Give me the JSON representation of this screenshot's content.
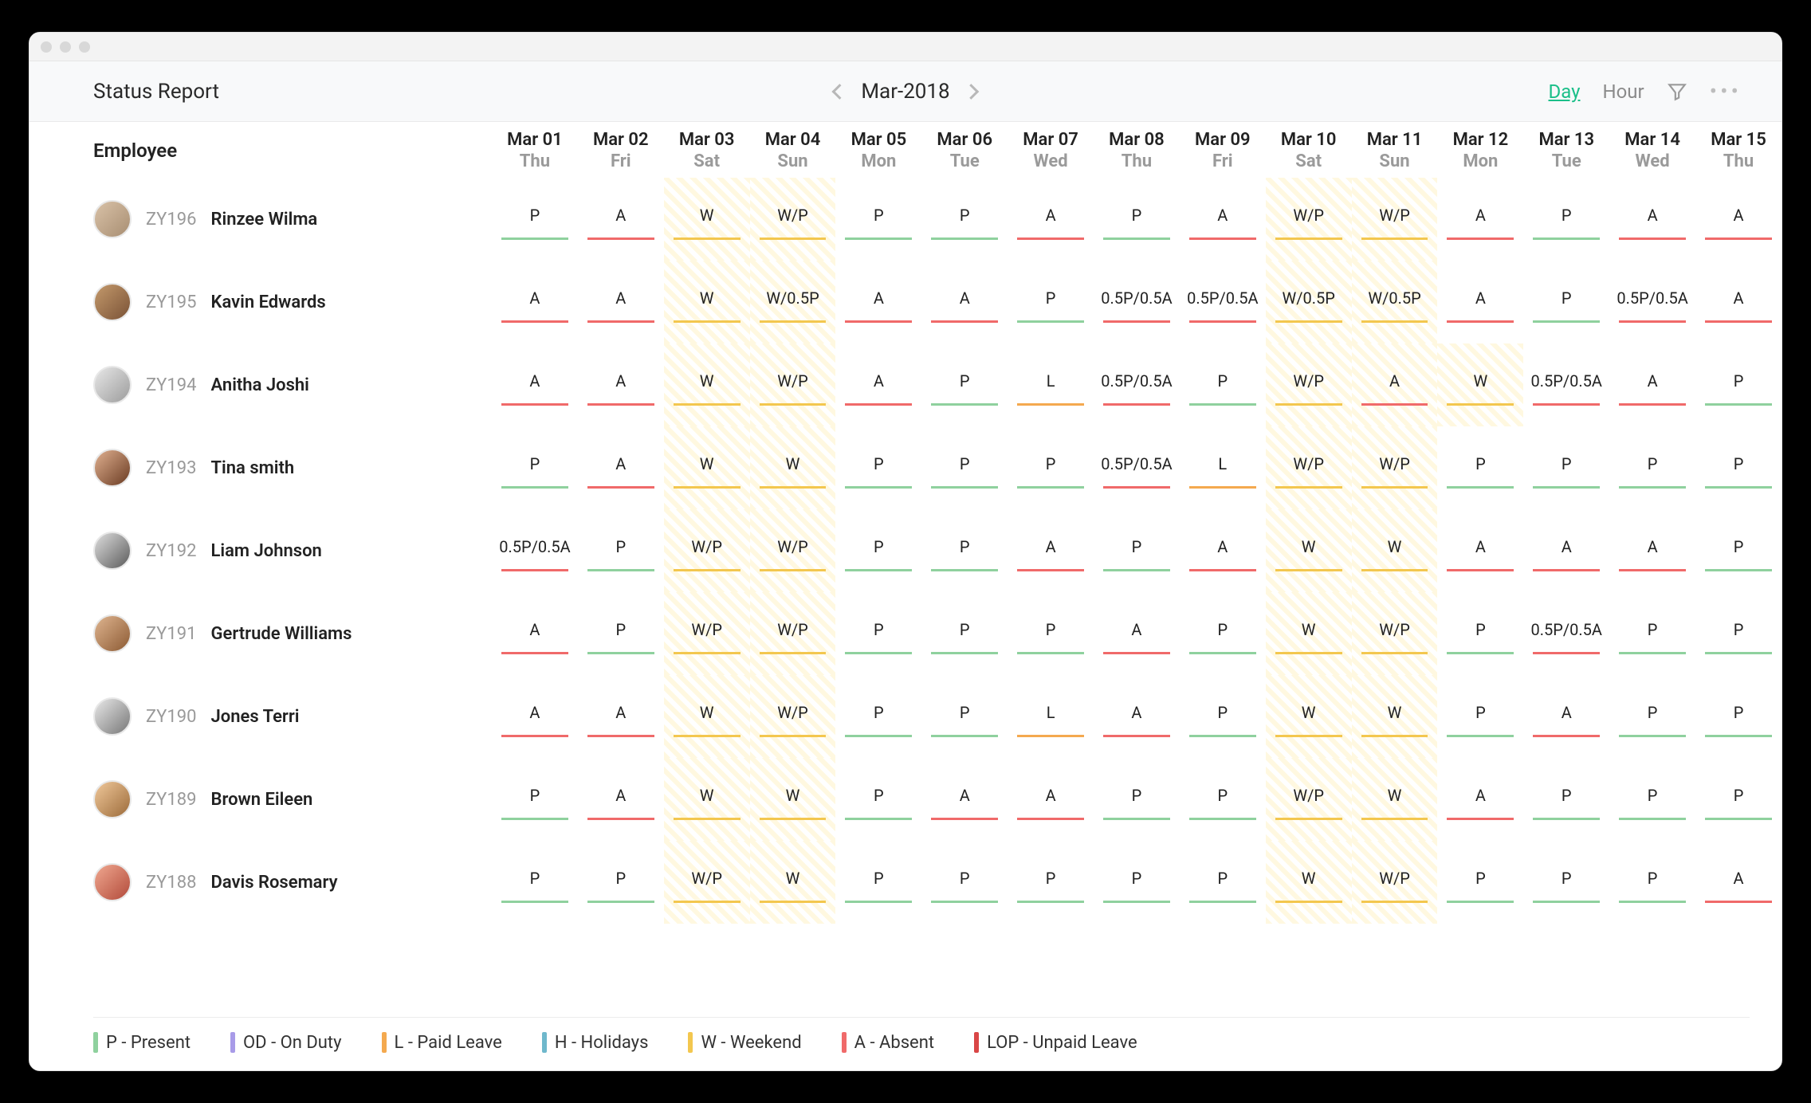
{
  "header": {
    "title": "Status Report",
    "period": "Mar-2018",
    "view_day": "Day",
    "view_hour": "Hour"
  },
  "columns_label": "Employee",
  "dates": [
    {
      "d1": "Mar 01",
      "d2": "Thu",
      "weekend": false
    },
    {
      "d1": "Mar 02",
      "d2": "Fri",
      "weekend": false
    },
    {
      "d1": "Mar 03",
      "d2": "Sat",
      "weekend": true
    },
    {
      "d1": "Mar 04",
      "d2": "Sun",
      "weekend": true
    },
    {
      "d1": "Mar 05",
      "d2": "Mon",
      "weekend": false
    },
    {
      "d1": "Mar 06",
      "d2": "Tue",
      "weekend": false
    },
    {
      "d1": "Mar 07",
      "d2": "Wed",
      "weekend": false
    },
    {
      "d1": "Mar 08",
      "d2": "Thu",
      "weekend": false
    },
    {
      "d1": "Mar 09",
      "d2": "Fri",
      "weekend": false
    },
    {
      "d1": "Mar 10",
      "d2": "Sat",
      "weekend": true
    },
    {
      "d1": "Mar 11",
      "d2": "Sun",
      "weekend": true
    },
    {
      "d1": "Mar 12",
      "d2": "Mon",
      "weekend": false
    },
    {
      "d1": "Mar 13",
      "d2": "Tue",
      "weekend": false
    },
    {
      "d1": "Mar 14",
      "d2": "Wed",
      "weekend": false
    },
    {
      "d1": "Mar 15",
      "d2": "Thu",
      "weekend": false
    }
  ],
  "rows": [
    {
      "id": "ZY196",
      "name": "Rinzee Wilma",
      "avatar": "a1",
      "cells": [
        {
          "t": "P",
          "c": "P"
        },
        {
          "t": "A",
          "c": "A"
        },
        {
          "t": "W",
          "c": "W"
        },
        {
          "t": "W/P",
          "c": "W"
        },
        {
          "t": "P",
          "c": "P"
        },
        {
          "t": "P",
          "c": "P"
        },
        {
          "t": "A",
          "c": "A"
        },
        {
          "t": "P",
          "c": "P"
        },
        {
          "t": "A",
          "c": "A"
        },
        {
          "t": "W/P",
          "c": "W"
        },
        {
          "t": "W/P",
          "c": "W"
        },
        {
          "t": "A",
          "c": "A"
        },
        {
          "t": "P",
          "c": "P"
        },
        {
          "t": "A",
          "c": "A"
        },
        {
          "t": "A",
          "c": "A"
        }
      ]
    },
    {
      "id": "ZY195",
      "name": "Kavin Edwards",
      "avatar": "a2",
      "cells": [
        {
          "t": "A",
          "c": "A"
        },
        {
          "t": "A",
          "c": "A"
        },
        {
          "t": "W",
          "c": "W"
        },
        {
          "t": "W/0.5P",
          "c": "W"
        },
        {
          "t": "A",
          "c": "A"
        },
        {
          "t": "A",
          "c": "A"
        },
        {
          "t": "P",
          "c": "P"
        },
        {
          "t": "0.5P/0.5A",
          "c": "A"
        },
        {
          "t": "0.5P/0.5A",
          "c": "A"
        },
        {
          "t": "W/0.5P",
          "c": "W"
        },
        {
          "t": "W/0.5P",
          "c": "W"
        },
        {
          "t": "A",
          "c": "A"
        },
        {
          "t": "P",
          "c": "P"
        },
        {
          "t": "0.5P/0.5A",
          "c": "A"
        },
        {
          "t": "A",
          "c": "A"
        }
      ]
    },
    {
      "id": "ZY194",
      "name": "Anitha Joshi",
      "avatar": "a3",
      "cells": [
        {
          "t": "A",
          "c": "A"
        },
        {
          "t": "A",
          "c": "A"
        },
        {
          "t": "W",
          "c": "W"
        },
        {
          "t": "W/P",
          "c": "W"
        },
        {
          "t": "A",
          "c": "A"
        },
        {
          "t": "P",
          "c": "P"
        },
        {
          "t": "L",
          "c": "L"
        },
        {
          "t": "0.5P/0.5A",
          "c": "A"
        },
        {
          "t": "P",
          "c": "P"
        },
        {
          "t": "W/P",
          "c": "W"
        },
        {
          "t": "A",
          "c": "A"
        },
        {
          "t": "W",
          "c": "W",
          "wk": true
        },
        {
          "t": "0.5P/0.5A",
          "c": "A"
        },
        {
          "t": "A",
          "c": "A"
        },
        {
          "t": "P",
          "c": "P"
        }
      ]
    },
    {
      "id": "ZY193",
      "name": "Tina smith",
      "avatar": "a4",
      "cells": [
        {
          "t": "P",
          "c": "P"
        },
        {
          "t": "A",
          "c": "A"
        },
        {
          "t": "W",
          "c": "W"
        },
        {
          "t": "W",
          "c": "W"
        },
        {
          "t": "P",
          "c": "P"
        },
        {
          "t": "P",
          "c": "P"
        },
        {
          "t": "P",
          "c": "P"
        },
        {
          "t": "0.5P/0.5A",
          "c": "A"
        },
        {
          "t": "L",
          "c": "L"
        },
        {
          "t": "W/P",
          "c": "W"
        },
        {
          "t": "W/P",
          "c": "W"
        },
        {
          "t": "P",
          "c": "P"
        },
        {
          "t": "P",
          "c": "P"
        },
        {
          "t": "P",
          "c": "P"
        },
        {
          "t": "P",
          "c": "P"
        }
      ]
    },
    {
      "id": "ZY192",
      "name": "Liam Johnson",
      "avatar": "a5",
      "cells": [
        {
          "t": "0.5P/0.5A",
          "c": "A"
        },
        {
          "t": "P",
          "c": "P"
        },
        {
          "t": "W/P",
          "c": "W"
        },
        {
          "t": "W/P",
          "c": "W"
        },
        {
          "t": "P",
          "c": "P"
        },
        {
          "t": "P",
          "c": "P"
        },
        {
          "t": "A",
          "c": "A"
        },
        {
          "t": "P",
          "c": "P"
        },
        {
          "t": "A",
          "c": "A"
        },
        {
          "t": "W",
          "c": "W"
        },
        {
          "t": "W",
          "c": "W"
        },
        {
          "t": "A",
          "c": "A"
        },
        {
          "t": "A",
          "c": "A"
        },
        {
          "t": "A",
          "c": "A"
        },
        {
          "t": "P",
          "c": "P"
        }
      ]
    },
    {
      "id": "ZY191",
      "name": "Gertrude Williams",
      "avatar": "a6",
      "cells": [
        {
          "t": "A",
          "c": "A"
        },
        {
          "t": "P",
          "c": "P"
        },
        {
          "t": "W/P",
          "c": "W"
        },
        {
          "t": "W/P",
          "c": "W"
        },
        {
          "t": "P",
          "c": "P"
        },
        {
          "t": "P",
          "c": "P"
        },
        {
          "t": "P",
          "c": "P"
        },
        {
          "t": "A",
          "c": "A"
        },
        {
          "t": "P",
          "c": "P"
        },
        {
          "t": "W",
          "c": "W"
        },
        {
          "t": "W/P",
          "c": "W"
        },
        {
          "t": "P",
          "c": "P"
        },
        {
          "t": "0.5P/0.5A",
          "c": "A"
        },
        {
          "t": "P",
          "c": "P"
        },
        {
          "t": "P",
          "c": "P"
        }
      ]
    },
    {
      "id": "ZY190",
      "name": "Jones Terri",
      "avatar": "a7",
      "cells": [
        {
          "t": "A",
          "c": "A"
        },
        {
          "t": "A",
          "c": "A"
        },
        {
          "t": "W",
          "c": "W"
        },
        {
          "t": "W/P",
          "c": "W"
        },
        {
          "t": "P",
          "c": "P"
        },
        {
          "t": "P",
          "c": "P"
        },
        {
          "t": "L",
          "c": "L"
        },
        {
          "t": "A",
          "c": "A"
        },
        {
          "t": "P",
          "c": "P"
        },
        {
          "t": "W",
          "c": "W"
        },
        {
          "t": "W",
          "c": "W"
        },
        {
          "t": "P",
          "c": "P"
        },
        {
          "t": "A",
          "c": "A"
        },
        {
          "t": "P",
          "c": "P"
        },
        {
          "t": "P",
          "c": "P"
        }
      ]
    },
    {
      "id": "ZY189",
      "name": "Brown Eileen",
      "avatar": "a8",
      "cells": [
        {
          "t": "P",
          "c": "P"
        },
        {
          "t": "A",
          "c": "A"
        },
        {
          "t": "W",
          "c": "W"
        },
        {
          "t": "W",
          "c": "W"
        },
        {
          "t": "P",
          "c": "P"
        },
        {
          "t": "A",
          "c": "A"
        },
        {
          "t": "A",
          "c": "A"
        },
        {
          "t": "P",
          "c": "P"
        },
        {
          "t": "P",
          "c": "P"
        },
        {
          "t": "W/P",
          "c": "W"
        },
        {
          "t": "W",
          "c": "W"
        },
        {
          "t": "A",
          "c": "A"
        },
        {
          "t": "P",
          "c": "P"
        },
        {
          "t": "P",
          "c": "P"
        },
        {
          "t": "P",
          "c": "P"
        }
      ]
    },
    {
      "id": "ZY188",
      "name": "Davis Rosemary",
      "avatar": "a9",
      "cells": [
        {
          "t": "P",
          "c": "P"
        },
        {
          "t": "P",
          "c": "P"
        },
        {
          "t": "W/P",
          "c": "W"
        },
        {
          "t": "W",
          "c": "W"
        },
        {
          "t": "P",
          "c": "P"
        },
        {
          "t": "P",
          "c": "P"
        },
        {
          "t": "P",
          "c": "P"
        },
        {
          "t": "P",
          "c": "P"
        },
        {
          "t": "P",
          "c": "P"
        },
        {
          "t": "W",
          "c": "W"
        },
        {
          "t": "W/P",
          "c": "W"
        },
        {
          "t": "P",
          "c": "P"
        },
        {
          "t": "P",
          "c": "P"
        },
        {
          "t": "P",
          "c": "P"
        },
        {
          "t": "A",
          "c": "A"
        }
      ]
    }
  ],
  "legend": [
    {
      "code": "P",
      "label": "P - Present"
    },
    {
      "code": "OD",
      "label": "OD - On Duty"
    },
    {
      "code": "L",
      "label": "L - Paid Leave"
    },
    {
      "code": "H",
      "label": "H - Holidays"
    },
    {
      "code": "W",
      "label": "W - Weekend"
    },
    {
      "code": "A",
      "label": "A - Absent"
    },
    {
      "code": "LOP",
      "label": "LOP - Unpaid Leave"
    }
  ]
}
